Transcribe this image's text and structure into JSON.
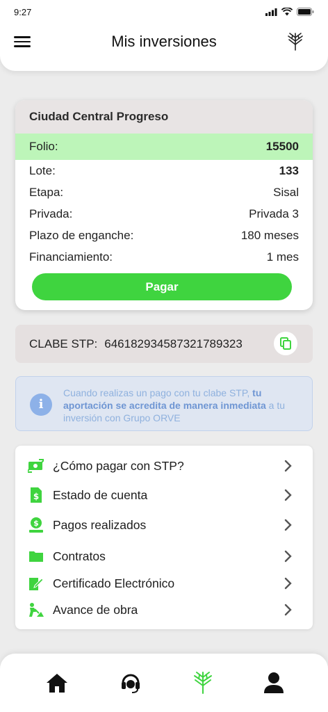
{
  "status": {
    "time": "9:27"
  },
  "header": {
    "title": "Mis inversiones"
  },
  "investment": {
    "project": "Ciudad Central Progreso",
    "rows": [
      {
        "label": "Folio:",
        "value": "15500"
      },
      {
        "label": "Lote:",
        "value": "133"
      },
      {
        "label": "Etapa:",
        "value": "Sisal"
      },
      {
        "label": "Privada:",
        "value": "Privada 3"
      },
      {
        "label": "Plazo de enganche:",
        "value": "180 meses"
      },
      {
        "label": "Financiamiento:",
        "value": "1 mes"
      }
    ],
    "pay_label": "Pagar"
  },
  "clabe": {
    "label": "CLABE STP:",
    "value": "646182934587321789323"
  },
  "info": {
    "text_start": "Cuando realizas un pago con tu clabe STP, ",
    "text_bold": "tu aportación se acredita de manera inmediata",
    "text_end": " a tu inversión con Grupo ORVE"
  },
  "menu": {
    "items": [
      {
        "label": "¿Cómo pagar con STP?",
        "icon": "money-transfer-icon"
      },
      {
        "label": "Estado de cuenta",
        "icon": "statement-icon"
      },
      {
        "label": "Pagos realizados",
        "icon": "payments-icon"
      },
      {
        "label": "Contratos",
        "icon": "folder-icon"
      },
      {
        "label": "Certificado Electrónico",
        "icon": "certificate-icon"
      },
      {
        "label": "Avance de obra",
        "icon": "construction-icon"
      }
    ]
  },
  "nav": {
    "items": [
      "home-icon",
      "support-headset-icon",
      "brand-tree-icon",
      "profile-icon"
    ]
  },
  "colors": {
    "accent_green": "#3fd43f",
    "highlight_green": "#bdf5b9",
    "info_blue": "#8db1e8"
  }
}
